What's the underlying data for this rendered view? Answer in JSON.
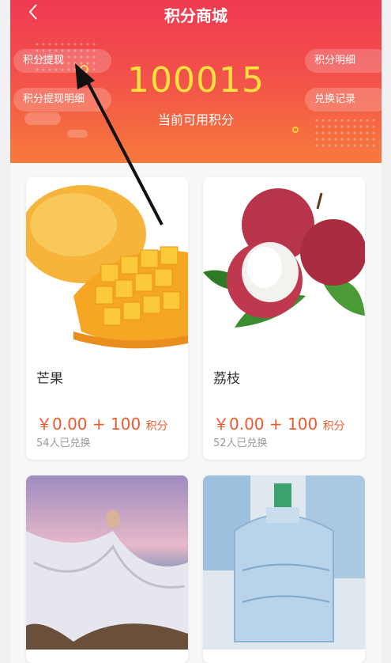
{
  "header": {
    "title": "积分商城",
    "back_icon": "chevron-left-icon",
    "buttons": {
      "withdraw": "积分提现",
      "withdraw_detail": "积分提现明细",
      "points_detail": "积分明细",
      "exchange_records": "兑换记录"
    },
    "points_value": "100015",
    "points_label": "当前可用积分"
  },
  "products": [
    {
      "name": "芒果",
      "price": "￥0.00",
      "plus": "+",
      "points": "100",
      "points_unit": "积分",
      "sold": "54人已兑换"
    },
    {
      "name": "荔枝",
      "price": "￥0.00",
      "plus": "+",
      "points": "100",
      "points_unit": "积分",
      "sold": "52人已兑换"
    },
    {
      "name": "",
      "price": "",
      "plus": "",
      "points": "",
      "points_unit": "",
      "sold": ""
    },
    {
      "name": "",
      "price": "",
      "plus": "",
      "points": "",
      "points_unit": "",
      "sold": ""
    }
  ],
  "colors": {
    "header_top": "#ef3a52",
    "header_bottom": "#f77a3c",
    "points_value": "#ffe23d",
    "price": "#ee5a2f"
  }
}
